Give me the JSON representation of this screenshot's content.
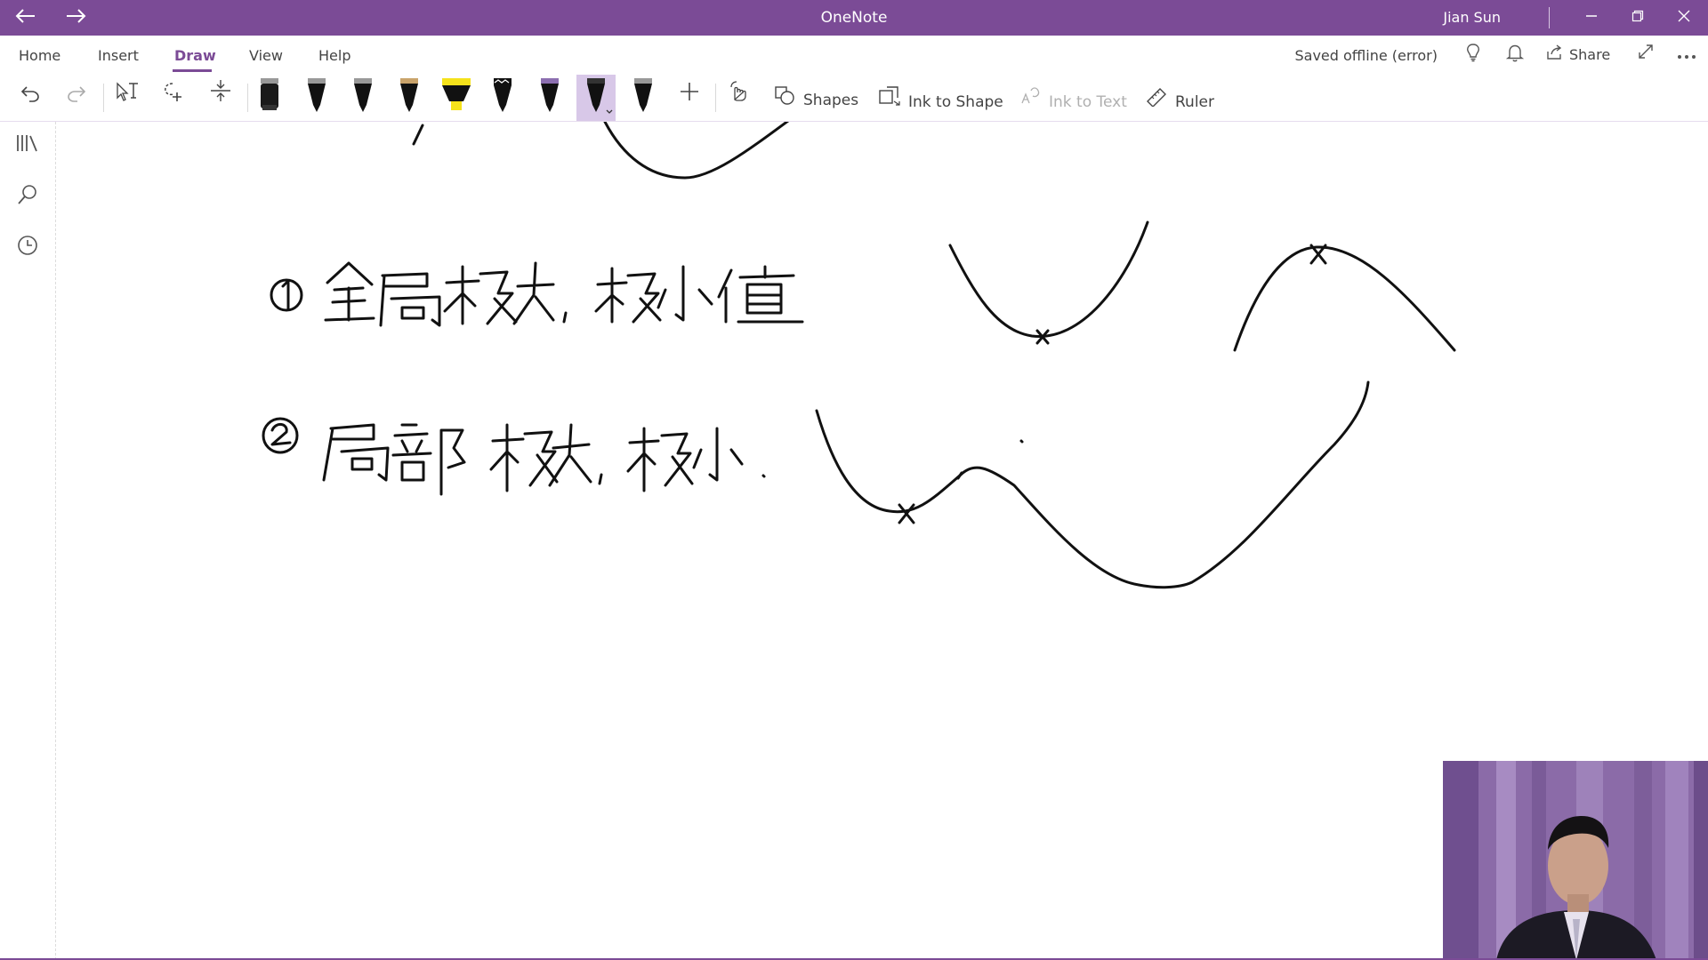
{
  "window": {
    "title": "OneNote",
    "user": "Jian Sun",
    "back_icon": "back-arrow-icon",
    "forward_icon": "forward-arrow-icon",
    "controls": [
      "minimize",
      "restore",
      "close"
    ]
  },
  "ribbon": {
    "tabs": [
      {
        "label": "Home",
        "active": false
      },
      {
        "label": "Insert",
        "active": false
      },
      {
        "label": "Draw",
        "active": true
      },
      {
        "label": "View",
        "active": false
      },
      {
        "label": "Help",
        "active": false
      }
    ],
    "status": "Saved offline (error)",
    "share_label": "Share"
  },
  "toolbar": {
    "shapes_label": "Shapes",
    "ink_to_shape_label": "Ink to Shape",
    "ink_to_text_label": "Ink to Text",
    "ruler_label": "Ruler",
    "pens": [
      {
        "name": "eraser",
        "color": "#222222"
      },
      {
        "name": "pen-1",
        "color": "#111111"
      },
      {
        "name": "pen-2",
        "color": "#111111"
      },
      {
        "name": "pen-3",
        "color": "#111111"
      },
      {
        "name": "highlighter",
        "color": "#f5e21b"
      },
      {
        "name": "galaxy-pen",
        "color": "#111111"
      },
      {
        "name": "pen-4",
        "color": "#111111"
      },
      {
        "name": "pen-selected",
        "color": "#111111",
        "selected": true
      },
      {
        "name": "pen-5",
        "color": "#111111"
      }
    ]
  },
  "nav": {
    "icons": [
      "notebooks-icon",
      "search-icon",
      "recent-icon"
    ]
  },
  "accent_color": "#7b4b96"
}
